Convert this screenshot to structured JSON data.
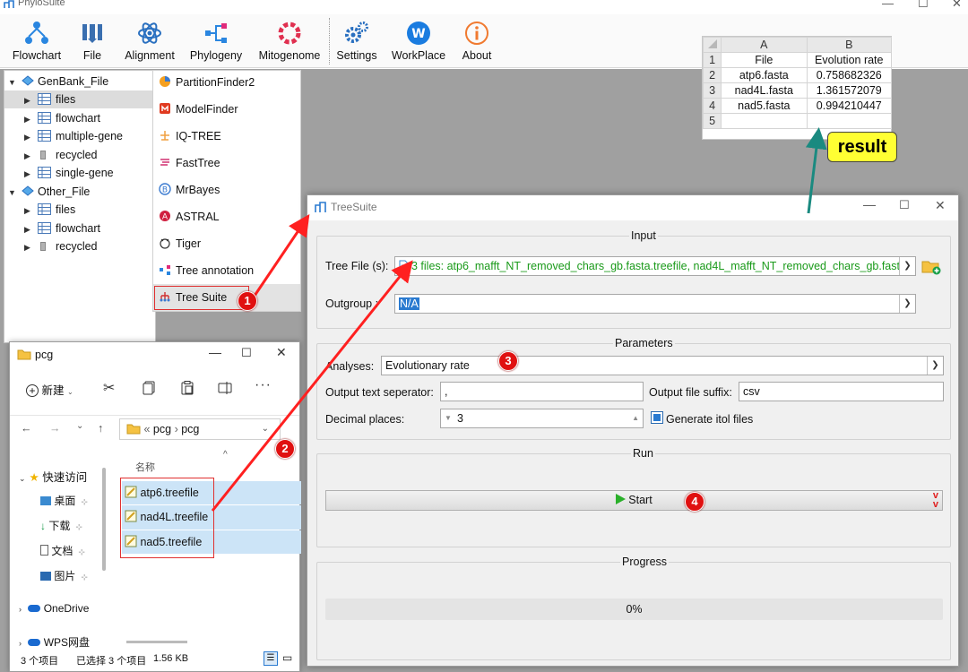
{
  "app": {
    "title": "PhyloSuite"
  },
  "toolbar": {
    "items": [
      {
        "label": "Flowchart"
      },
      {
        "label": "File"
      },
      {
        "label": "Alignment"
      },
      {
        "label": "Phylogeny"
      },
      {
        "label": "Mitogenome"
      },
      {
        "label": "Settings"
      },
      {
        "label": "WorkPlace"
      },
      {
        "label": "About"
      }
    ]
  },
  "tree": {
    "nodes": [
      {
        "label": "GenBank_File",
        "icon": "folder-icon"
      },
      {
        "label": "files",
        "icon": "table-icon"
      },
      {
        "label": "flowchart",
        "icon": "table-icon"
      },
      {
        "label": "multiple-gene",
        "icon": "table-icon"
      },
      {
        "label": "recycled",
        "icon": "trash-icon"
      },
      {
        "label": "single-gene",
        "icon": "table-icon"
      },
      {
        "label": "Other_File",
        "icon": "folder-icon"
      },
      {
        "label": "files",
        "icon": "table-icon"
      },
      {
        "label": "flowchart",
        "icon": "table-icon"
      },
      {
        "label": "recycled",
        "icon": "trash-icon"
      }
    ]
  },
  "phylo_menu": {
    "items": [
      {
        "label": "PartitionFinder2"
      },
      {
        "label": "ModelFinder"
      },
      {
        "label": "IQ-TREE"
      },
      {
        "label": "FastTree"
      },
      {
        "label": "MrBayes"
      },
      {
        "label": "ASTRAL"
      },
      {
        "label": "Tiger"
      },
      {
        "label": "Tree annotation"
      },
      {
        "label": "Tree Suite"
      }
    ]
  },
  "excel": {
    "col_headers": [
      "A",
      "B"
    ],
    "row_numbers": [
      "1",
      "2",
      "3",
      "4",
      "5"
    ],
    "rows": [
      [
        "File",
        "Evolution rate"
      ],
      [
        "atp6.fasta",
        "0.758682326"
      ],
      [
        "nad4L.fasta",
        "1.361572079"
      ],
      [
        "nad5.fasta",
        "0.994210447"
      ],
      [
        "",
        ""
      ]
    ]
  },
  "result_label": "result",
  "treesuite": {
    "title": "TreeSuite",
    "input": {
      "group_title": "Input",
      "tree_file_label": "Tree File (s):",
      "tree_file_value": "3 files: atp6_mafft_NT_removed_chars_gb.fasta.treefile, nad4L_mafft_NT_removed_chars_gb.fast",
      "outgroup_label": "Outgroup :",
      "outgroup_value": "N/A"
    },
    "params": {
      "group_title": "Parameters",
      "analyses_label": "Analyses:",
      "analyses_value": "Evolutionary rate",
      "sep_label": "Output text seperator:",
      "sep_value": ",",
      "suffix_label": "Output file suffix:",
      "suffix_value": "csv",
      "decimal_label": "Decimal places:",
      "decimal_value": "3",
      "itol_label": "Generate itol files",
      "itol_checked": true
    },
    "run": {
      "group_title": "Run",
      "start_label": "Start"
    },
    "progress": {
      "group_title": "Progress",
      "value_text": "0%",
      "value": 0
    }
  },
  "explorer": {
    "title": "pcg",
    "new_label": "新建",
    "breadcrumb": {
      "prefix": "«",
      "parts": [
        "pcg",
        "pcg"
      ]
    },
    "column_name": "名称",
    "nav": [
      {
        "label": "快速访问",
        "icon": "star-icon"
      },
      {
        "label": "桌面",
        "icon": "desktop-icon"
      },
      {
        "label": "下载",
        "icon": "download-icon"
      },
      {
        "label": "文档",
        "icon": "document-icon"
      },
      {
        "label": "图片",
        "icon": "picture-icon"
      },
      {
        "label": "OneDrive",
        "icon": "cloud-icon"
      },
      {
        "label": "WPS网盘",
        "icon": "cloud-icon"
      }
    ],
    "files": [
      {
        "name": "atp6.treefile"
      },
      {
        "name": "nad4L.treefile"
      },
      {
        "name": "nad5.treefile"
      }
    ],
    "status": {
      "count": "3 个项目",
      "selected": "已选择 3 个项目",
      "size": "1.56 KB"
    }
  },
  "badges": [
    "1",
    "2",
    "3",
    "4"
  ],
  "colors": {
    "annotation_red": "#e01010",
    "arrow_teal": "#1a8a80",
    "result_yellow": "#ffff33",
    "selection_blue": "#cce4f7",
    "tree_file_green": "#1a9a1a"
  }
}
